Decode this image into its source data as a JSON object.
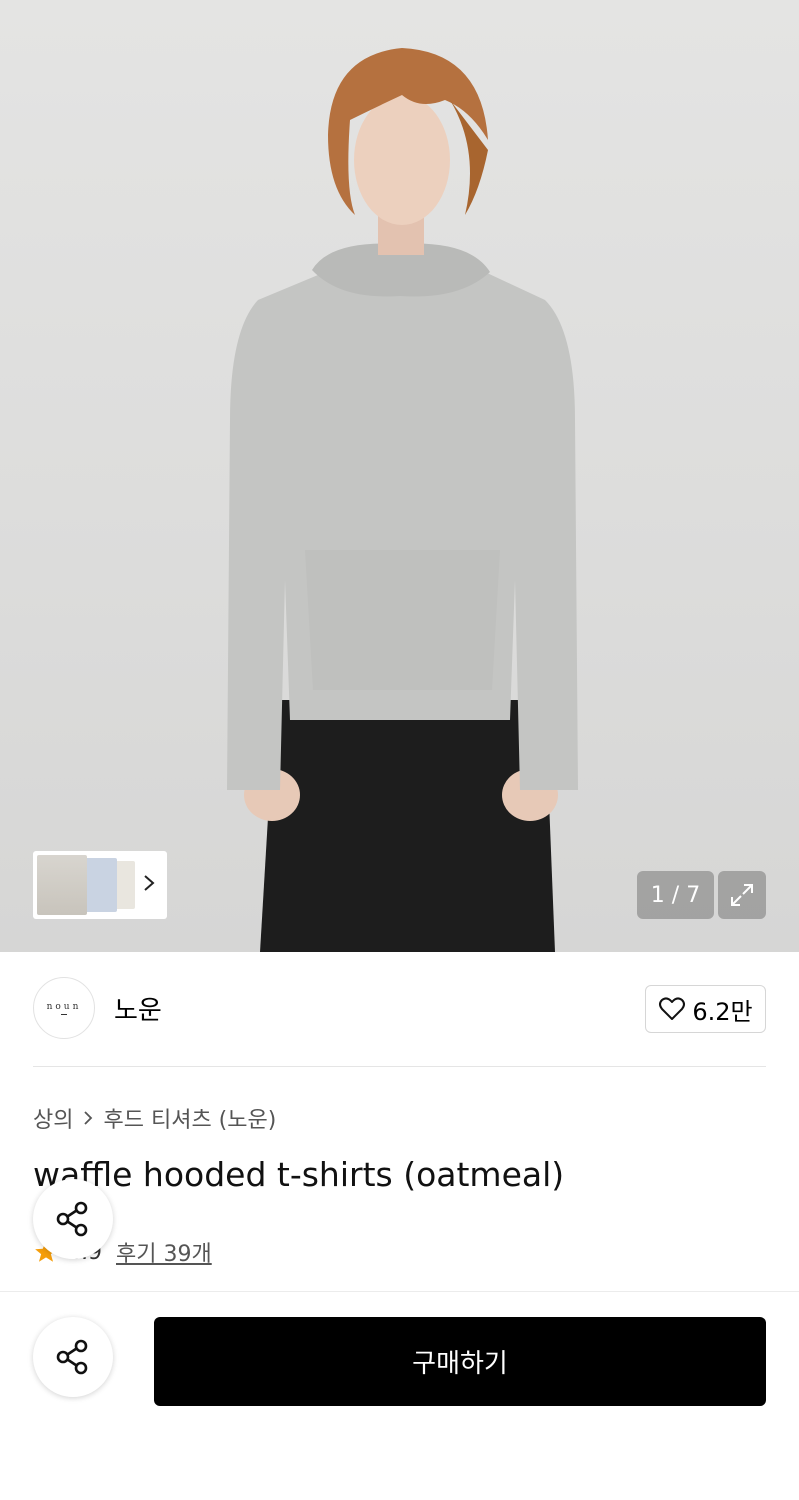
{
  "gallery": {
    "counter": "1 / 7",
    "thumbnails": [
      "thumb-1",
      "thumb-2",
      "thumb-3"
    ]
  },
  "brand": {
    "logo_text": "noun",
    "name": "노운",
    "likes": "6.2만"
  },
  "breadcrumb": [
    "상의",
    "후드 티셔츠 (노운)"
  ],
  "product": {
    "title": "waffle hooded t-shirts (oatmeal)",
    "rating": "4.9",
    "reviews": "후기 39개"
  },
  "actions": {
    "buy_label": "구매하기"
  },
  "colors": {
    "star": "#f59e0b",
    "buy_bg": "#000000"
  },
  "icons": [
    "chevron-right-icon",
    "expand-icon",
    "heart-icon",
    "share-icon",
    "star-icon"
  ]
}
